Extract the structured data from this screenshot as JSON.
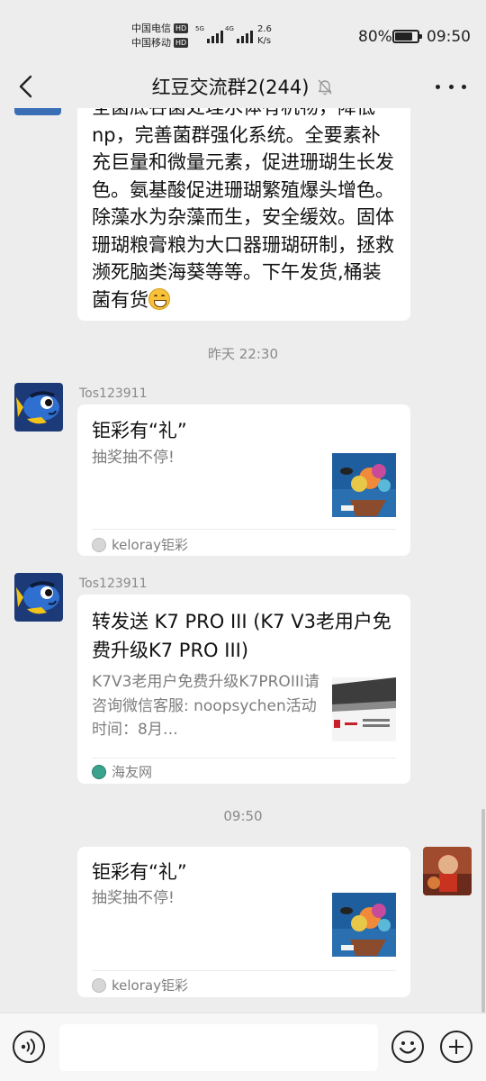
{
  "status_bar": {
    "carrier_1": "中国电信",
    "carrier_2": "中国移动",
    "hd_badge": "HD",
    "net_1": "5G",
    "net_2": "4G",
    "speed_value": "2.6",
    "speed_unit": "K/s",
    "battery_percent": "80%",
    "battery_level": 0.8,
    "time": "09:50"
  },
  "header": {
    "title": "红豆交流群2(244)",
    "back_icon": "chevron-left-icon",
    "mute_icon": "bell-off-icon",
    "more_icon": "more-dots-icon"
  },
  "messages": {
    "text_message": "全菌底谷菌处理水体有机物，降低np，完善菌群强化系统。全要素补充巨量和微量元素，促进珊瑚生长发色。氨基酸促进珊瑚繁殖爆头增色。除藻水为杂藻而生，安全缓效。固体珊瑚粮膏粮为大口器珊瑚研制，拯救濒死脑类海葵等等。下午发货,桶装菌有货",
    "timestamp_1": "昨天 22:30",
    "msg1": {
      "sender": "Tos123911",
      "title": "钜彩有“礼”",
      "desc": "抽奖抽不停!",
      "source": "keloray钜彩"
    },
    "msg2": {
      "sender": "Tos123911",
      "title": "转发送 K7 PRO III (K7 V3老用户免费升级K7 PRO III)",
      "desc": "K7V3老用户免费升级K7PROIII请咨询微信客服: noopsychen活动时间：8月…",
      "source": "海友网"
    },
    "timestamp_2": "09:50",
    "msg3": {
      "title": "钜彩有“礼”",
      "desc": "抽奖抽不停!",
      "source": "keloray钜彩"
    }
  },
  "input_bar": {
    "voice_icon": "voice-icon",
    "emoji_icon": "emoji-icon",
    "plus_icon": "plus-icon"
  }
}
